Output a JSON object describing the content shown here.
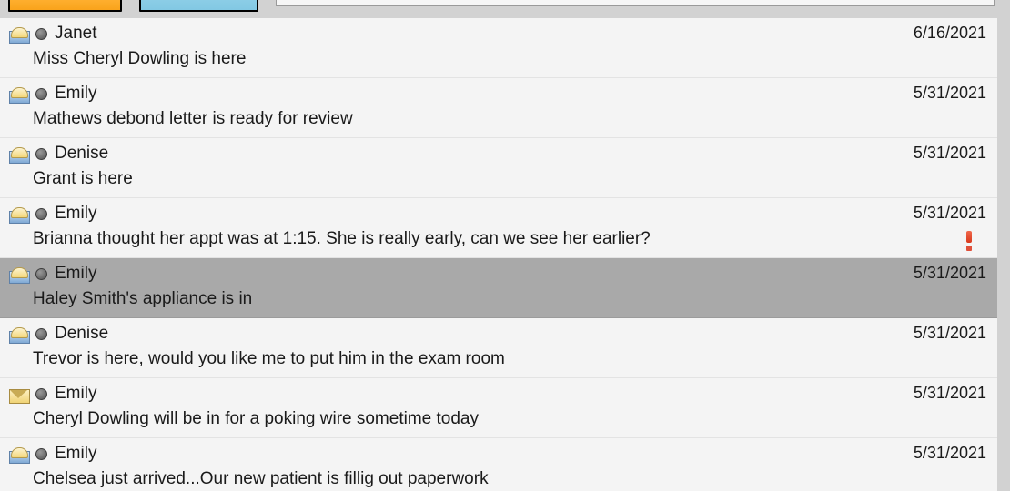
{
  "toolbar": {
    "button_orange_label": "",
    "button_blue_label": "",
    "search_value": "",
    "search_placeholder": ""
  },
  "messages": [
    {
      "sender": "Janet",
      "date": "6/16/2021",
      "body_link": "Miss Cheryl Dowling",
      "body_rest": " is here",
      "read": true,
      "selected": false,
      "priority": false
    },
    {
      "sender": "Emily",
      "date": "5/31/2021",
      "body_link": "",
      "body_rest": "Mathews debond letter is ready for review",
      "read": true,
      "selected": false,
      "priority": false
    },
    {
      "sender": "Denise",
      "date": "5/31/2021",
      "body_link": "",
      "body_rest": "Grant is here",
      "read": true,
      "selected": false,
      "priority": false
    },
    {
      "sender": "Emily",
      "date": "5/31/2021",
      "body_link": "",
      "body_rest": "Brianna thought her appt was at 1:15.  She is really early, can we see her earlier?",
      "read": true,
      "selected": false,
      "priority": true
    },
    {
      "sender": "Emily",
      "date": "5/31/2021",
      "body_link": "",
      "body_rest": "Haley Smith's appliance is in",
      "read": true,
      "selected": true,
      "priority": false
    },
    {
      "sender": "Denise",
      "date": "5/31/2021",
      "body_link": "",
      "body_rest": "Trevor is here, would you like me to put him in the exam room",
      "read": true,
      "selected": false,
      "priority": false
    },
    {
      "sender": "Emily",
      "date": "5/31/2021",
      "body_link": "",
      "body_rest": "Cheryl Dowling will be in for a poking wire sometime today",
      "read": false,
      "selected": false,
      "priority": false
    },
    {
      "sender": "Emily",
      "date": "5/31/2021",
      "body_link": "",
      "body_rest": "Chelsea just arrived...Our new patient is fillig out paperwork",
      "read": true,
      "selected": false,
      "priority": false
    }
  ],
  "colors": {
    "selection": "#a9a9a9",
    "row_background": "#f4f4f4",
    "separator": "#e3e3e3",
    "chrome": "#d2d2d2",
    "button_orange": "#f9a31b",
    "button_blue": "#8bcde6",
    "priority": "#d9391c"
  }
}
